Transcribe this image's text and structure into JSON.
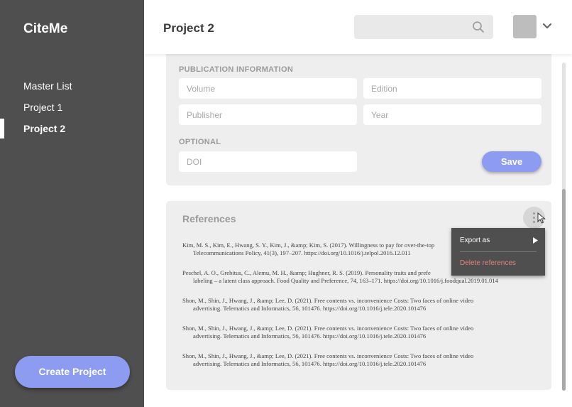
{
  "app": {
    "name": "CiteMe"
  },
  "sidebar": {
    "items": [
      {
        "label": "Master List"
      },
      {
        "label": "Project 1"
      },
      {
        "label": "Project 2",
        "active": true
      }
    ],
    "create_button": "Create Project"
  },
  "header": {
    "title": "Project 2",
    "search": {
      "value": "",
      "placeholder": ""
    },
    "search_icon": "search-icon",
    "account_icon": "chevron-down-icon"
  },
  "publication": {
    "section_label": "PUBLICATION INFORMATION",
    "volume_placeholder": "Volume",
    "edition_placeholder": "Edition",
    "publisher_placeholder": "Publisher",
    "year_placeholder": "Year",
    "optional_label": "OPTIONAL",
    "doi_placeholder": "DOI",
    "save_label": "Save"
  },
  "references": {
    "title": "References",
    "more_icon": "more-vertical-icon",
    "items": [
      {
        "line1": "Kim, M. S., Kim, E., Hwang, S. Y., Kim, J., &amp; Kim, S. (2017). Willingness to pay for over-the-top",
        "line2": "Telecommunications Policy, 41(3), 197–207. https://doi.org/10.1016/j.telpol.2016.12.011"
      },
      {
        "line1": "Peschel, A. O., Grebitus, C., Alemu, M. H., &amp; Hughner, R. S. (2019). Personality traits and prefe",
        "line2": "labeling – a latent class approach. Food Quality and Preference, 74, 163–171. https://doi.org/10.1016/j.foodqual.2019.01.014"
      },
      {
        "line1": "Shon, M., Shin, J., Hwang, J., &amp; Lee, D. (2021). Free contents vs. inconvenience Costs: Two faces of online video",
        "line2": "advertising. Telematics and Informatics, 56, 101476. https://doi.org/10.1016/j.tele.2020.101476"
      },
      {
        "line1": "Shon, M., Shin, J., Hwang, J., &amp; Lee, D. (2021). Free contents vs. inconvenience Costs: Two faces of online video",
        "line2": "advertising. Telematics and Informatics, 56, 101476. https://doi.org/10.1016/j.tele.2020.101476"
      },
      {
        "line1": "Shon, M., Shin, J., Hwang, J., &amp; Lee, D. (2021). Free contents vs. inconvenience Costs: Two faces of online video",
        "line2": "advertising. Telematics and Informatics, 56, 101476. https://doi.org/10.1016/j.tele.2020.101476"
      }
    ]
  },
  "context_menu": {
    "export_label": "Export as",
    "delete_label": "Delete references",
    "delete_color": "#e2837a"
  },
  "colors": {
    "sidebar": "#4f4f4f",
    "accent": "#8d9cf0",
    "card": "#eeeeee"
  }
}
